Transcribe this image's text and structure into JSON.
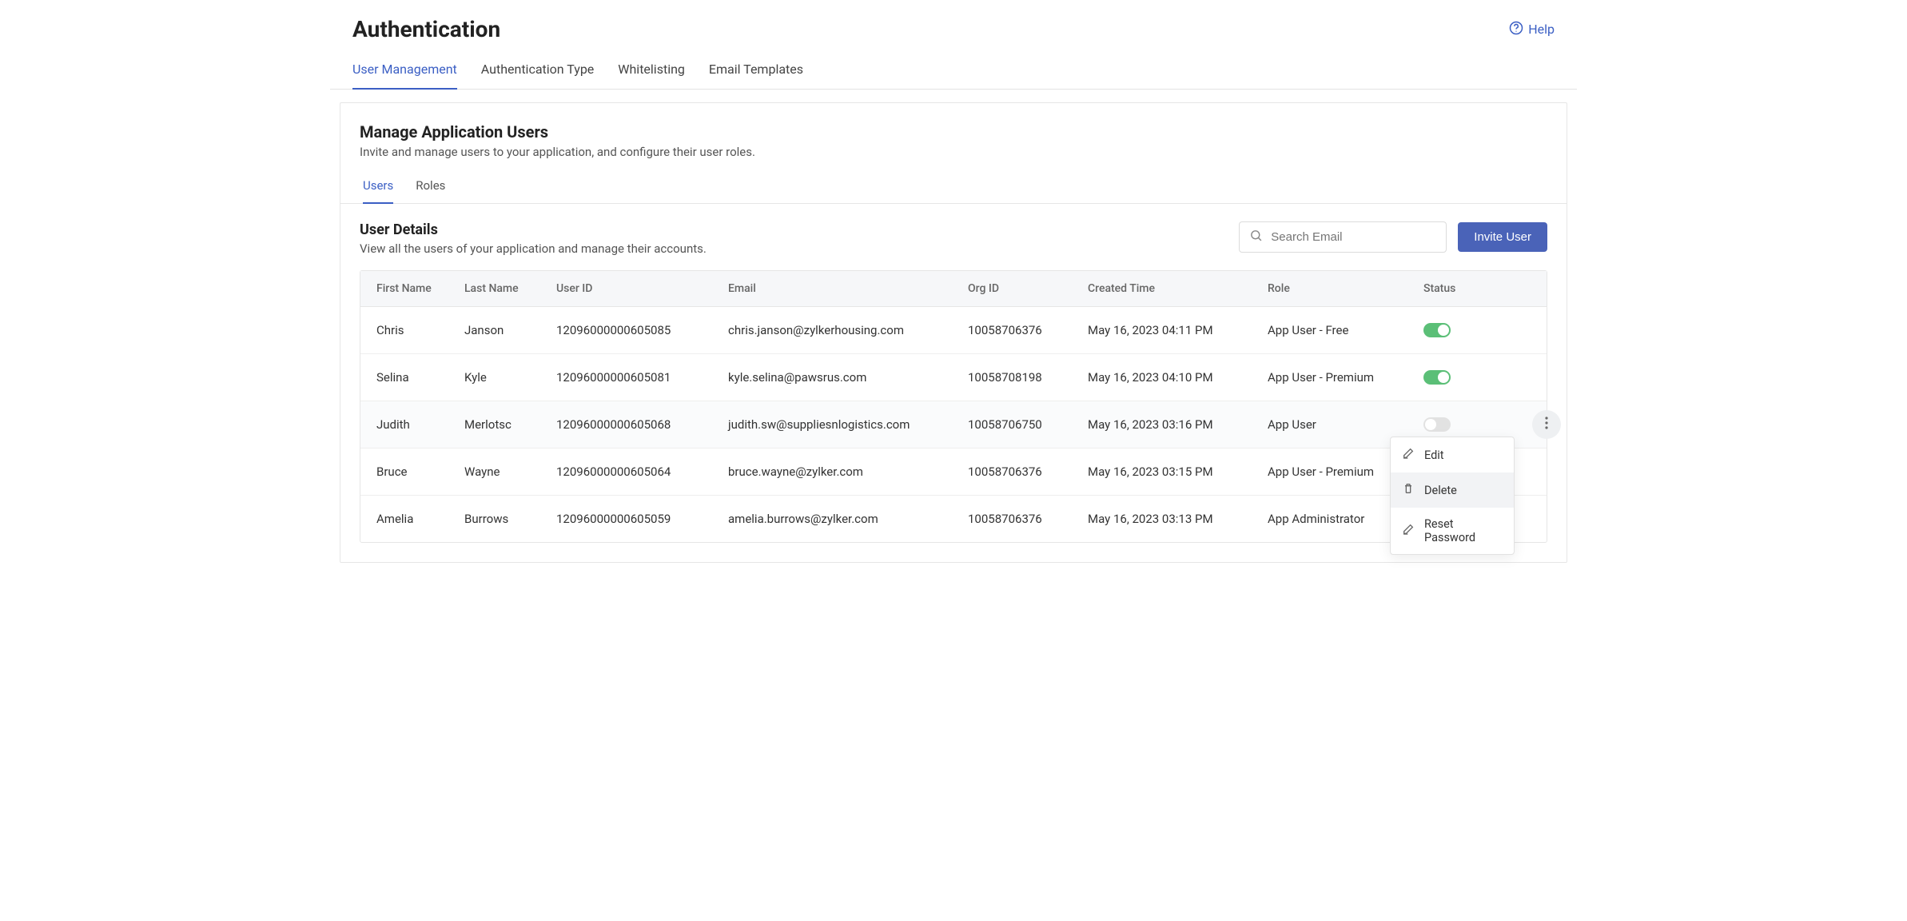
{
  "header": {
    "title": "Authentication",
    "help_label": "Help"
  },
  "main_tabs": [
    {
      "label": "User Management",
      "active": true
    },
    {
      "label": "Authentication Type",
      "active": false
    },
    {
      "label": "Whitelisting",
      "active": false
    },
    {
      "label": "Email Templates",
      "active": false
    }
  ],
  "section": {
    "title": "Manage Application Users",
    "subtitle": "Invite and manage users to your application, and configure their user roles."
  },
  "sub_tabs": [
    {
      "label": "Users",
      "active": true
    },
    {
      "label": "Roles",
      "active": false
    }
  ],
  "details": {
    "title": "User Details",
    "subtitle": "View all the users of your application and manage their accounts."
  },
  "search": {
    "placeholder": "Search Email"
  },
  "invite_label": "Invite User",
  "columns": {
    "first": "First Name",
    "last": "Last Name",
    "userid": "User ID",
    "email": "Email",
    "orgid": "Org ID",
    "created": "Created Time",
    "role": "Role",
    "status": "Status"
  },
  "rows": [
    {
      "first": "Chris",
      "last": "Janson",
      "userid": "12096000000605085",
      "email": "chris.janson@zylkerhousing.com",
      "orgid": "10058706376",
      "created": "May 16, 2023 04:11 PM",
      "role": "App User - Free",
      "status_on": true,
      "hovered": false,
      "show_more": false
    },
    {
      "first": "Selina",
      "last": "Kyle",
      "userid": "12096000000605081",
      "email": "kyle.selina@pawsrus.com",
      "orgid": "10058708198",
      "created": "May 16, 2023 04:10 PM",
      "role": "App User - Premium",
      "status_on": true,
      "hovered": false,
      "show_more": false
    },
    {
      "first": "Judith",
      "last": "Merlotsc",
      "userid": "12096000000605068",
      "email": "judith.sw@suppliesnlogistics.com",
      "orgid": "10058706750",
      "created": "May 16, 2023 03:16 PM",
      "role": "App User",
      "status_on": false,
      "hovered": true,
      "show_more": true
    },
    {
      "first": "Bruce",
      "last": "Wayne",
      "userid": "12096000000605064",
      "email": "bruce.wayne@zylker.com",
      "orgid": "10058706376",
      "created": "May 16, 2023 03:15 PM",
      "role": "App User - Premium",
      "status_on": false,
      "hovered": false,
      "show_more": false
    },
    {
      "first": "Amelia",
      "last": "Burrows",
      "userid": "12096000000605059",
      "email": "amelia.burrows@zylker.com",
      "orgid": "10058706376",
      "created": "May 16, 2023 03:13 PM",
      "role": "App Administrator",
      "status_on": false,
      "hovered": false,
      "show_more": false
    }
  ],
  "context_menu": {
    "edit": "Edit",
    "delete": "Delete",
    "reset": "Reset Password"
  }
}
